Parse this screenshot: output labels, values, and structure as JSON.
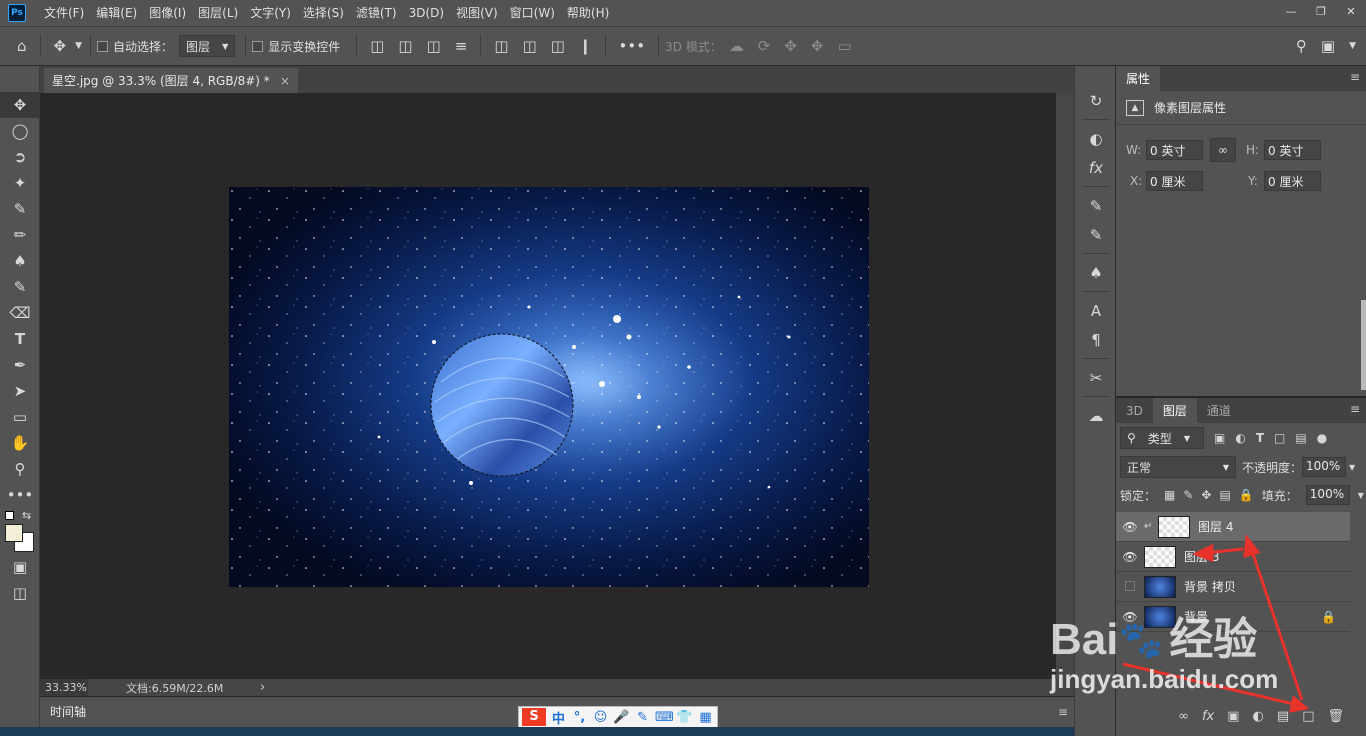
{
  "app": {
    "logo": "Ps"
  },
  "menubar": {
    "items": [
      "文件(F)",
      "编辑(E)",
      "图像(I)",
      "图层(L)",
      "文字(Y)",
      "选择(S)",
      "滤镜(T)",
      "3D(D)",
      "视图(V)",
      "窗口(W)",
      "帮助(H)"
    ]
  },
  "options": {
    "auto_select_label": "自动选择：",
    "auto_select_target": "图层",
    "show_transform_label": "显示变换控件",
    "mode_3d_label": "3D 模式："
  },
  "document": {
    "tab_title": "星空.jpg @ 33.3% (图层 4, RGB/8#) *",
    "close_glyph": "×"
  },
  "status": {
    "zoom": "33.33%",
    "doc_info": "文档:6.59M/22.6M",
    "arrow": "›"
  },
  "timeline": {
    "label": "时间轴"
  },
  "properties": {
    "tab_label": "属性",
    "header": "像素图层属性",
    "w_label": "W:",
    "w_value": "0 英寸",
    "h_label": "H:",
    "h_value": "0 英寸",
    "x_label": "X:",
    "x_value": "0 厘米",
    "y_label": "Y:",
    "y_value": "0 厘米"
  },
  "layers_panel": {
    "tabs": [
      "3D",
      "图层",
      "通道"
    ],
    "filter_label": "类型",
    "blend_mode": "正常",
    "opacity_label": "不透明度：",
    "opacity_value": "100%",
    "lock_label": "锁定：",
    "fill_label": "填充：",
    "fill_value": "100%",
    "layers": [
      {
        "name": "图层 4",
        "visible": true,
        "selected": true
      },
      {
        "name": "图层 3",
        "visible": true,
        "selected": false
      },
      {
        "name": "背景 拷贝",
        "visible": false,
        "selected": false
      },
      {
        "name": "背景",
        "visible": true,
        "selected": false
      }
    ]
  },
  "watermark": {
    "brand_left": "Bai",
    "brand_right": "经验",
    "url": "jingyan.baidu.com"
  },
  "ime": {
    "logo": "S",
    "items": [
      "中",
      "°,",
      "☺",
      "🎤",
      "✎",
      "⌨",
      "👕",
      "▦"
    ]
  }
}
